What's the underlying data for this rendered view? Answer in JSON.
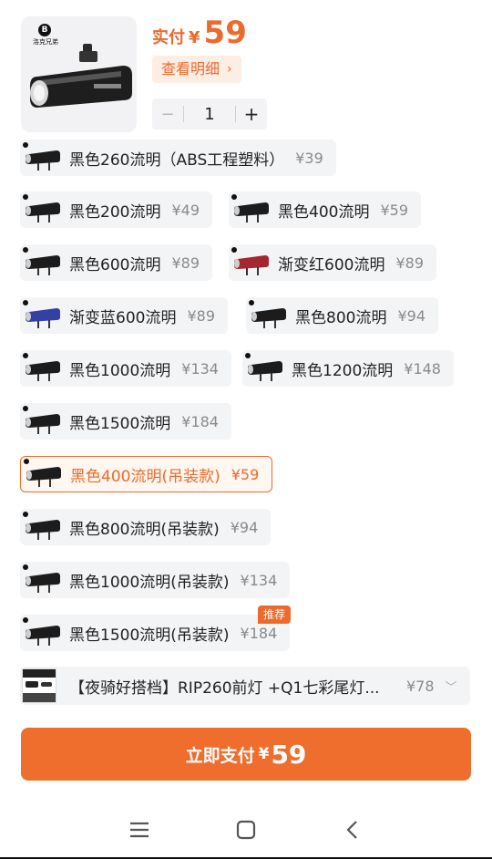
{
  "header": {
    "brand_text": "洛克兄弟",
    "price_label": "实付",
    "currency": "¥",
    "price": "59",
    "detail_label": "查看明细",
    "quantity": "1",
    "minus": "−",
    "plus": "+"
  },
  "options": [
    {
      "name": "黑色260流明（ABS工程塑料）",
      "price": "¥39",
      "tint": "#1c1c1c"
    },
    {
      "name": "黑色200流明",
      "price": "¥49",
      "tint": "#1c1c1c"
    },
    {
      "name": "黑色400流明",
      "price": "¥59",
      "tint": "#1c1c1c"
    },
    {
      "name": "黑色600流明",
      "price": "¥89",
      "tint": "#1c1c1c"
    },
    {
      "name": "渐变红600流明",
      "price": "¥89",
      "tint": "#a32630"
    },
    {
      "name": "渐变蓝600流明",
      "price": "¥89",
      "tint": "#3340a6"
    },
    {
      "name": "黑色800流明",
      "price": "¥94",
      "tint": "#1c1c1c"
    },
    {
      "name": "黑色1000流明",
      "price": "¥134",
      "tint": "#1c1c1c"
    },
    {
      "name": "黑色1200流明",
      "price": "¥148",
      "tint": "#1c1c1c"
    },
    {
      "name": "黑色1500流明",
      "price": "¥184",
      "tint": "#1c1c1c"
    },
    {
      "name": "黑色400流明(吊装款)",
      "price": "¥59",
      "tint": "#1c1c1c",
      "selected": true
    },
    {
      "name": "黑色800流明(吊装款)",
      "price": "¥94",
      "tint": "#1c1c1c"
    },
    {
      "name": "黑色1000流明(吊装款)",
      "price": "¥134",
      "tint": "#1c1c1c"
    },
    {
      "name": "黑色1500流明(吊装款)",
      "price": "¥184",
      "tint": "#1c1c1c"
    }
  ],
  "badge": "推荐",
  "combo": {
    "name": "【夜骑好搭档】RIP260前灯 +Q1七彩尾灯...",
    "price": "¥78"
  },
  "pay": {
    "label": "立即支付",
    "currency": "¥",
    "amount": "59"
  },
  "colors": {
    "accent": "#ec6a2c",
    "pay_button": "#ef6d2d",
    "chip_bg": "#f3f4f6"
  },
  "nav": {
    "icons": [
      "menu-icon",
      "home-icon",
      "back-icon"
    ]
  }
}
